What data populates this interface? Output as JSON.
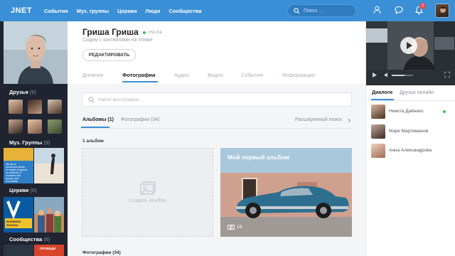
{
  "header": {
    "logo": "JNET",
    "nav": [
      "События",
      "Муз. группы",
      "Церкви",
      "Люди",
      "Сообщества"
    ],
    "search_placeholder": "Поиск ...",
    "notification_count": "2",
    "accent": "#3a8fd6"
  },
  "sidebar": {
    "friends_label": "Друзья",
    "friends_count": "(6)",
    "groups_label": "Муз. Группы",
    "groups_count": "(9)",
    "churches_label": "Церкви",
    "churches_count": "(6)",
    "communities_label": "Сообщества",
    "communities_count": "(6)",
    "group_tile_text": [
      "We are a",
      "full-service studio",
      "of master programs",
      "for all kinds of",
      "churches and",
      "groups, and",
      "non-profits."
    ],
    "church_tile_text": [
      "V",
      "BUSINESS",
      "SCHOOL"
    ],
    "bottom_tile_text": "ПРОВЕДИ"
  },
  "profile": {
    "name": "Гриша Гриша",
    "online_label": "ONLINE",
    "status": "Сидим с коктейлями на пляже",
    "edit_button": "РЕДАКТИРОВАТЬ"
  },
  "tabs": [
    "Дневник",
    "Фотографии",
    "Аудио",
    "Видео",
    "События",
    "Информация"
  ],
  "active_tab": "Фотографии",
  "photos": {
    "search_placeholder": "Найти фотографии...",
    "subtab_albums": "Альбомы (1)",
    "subtab_photos": "Фотографии (34)",
    "advanced_search": "Расширенный поиск",
    "albums_count_label": "1 альбом",
    "create_album": "Создать альбом",
    "album_title": "Мой первый альбом",
    "album_photo_count": "19",
    "photos_section_label": "Фотографии (34)"
  },
  "right": {
    "tab_dialogs": "Диалоги",
    "tab_friends_online": "Друзья онлайн",
    "contacts": [
      {
        "name": "Никита Дайнеко",
        "online": true
      },
      {
        "name": "Марк Мартиманов",
        "online": false
      },
      {
        "name": "Анна Александрова",
        "online": false
      }
    ]
  }
}
